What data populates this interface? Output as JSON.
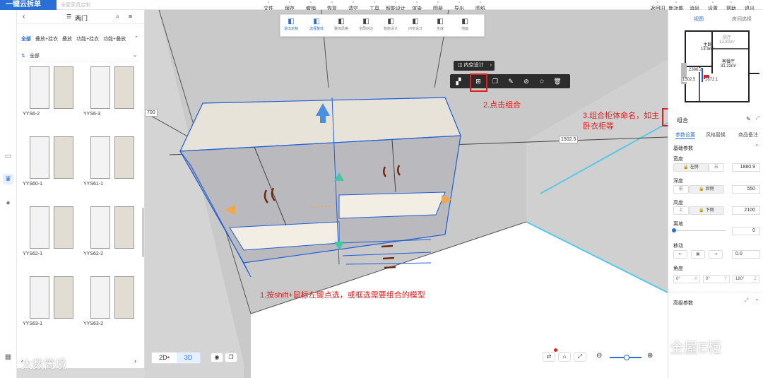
{
  "app": {
    "logo": "一键云拆单",
    "logo_sub": "全屋家具定制"
  },
  "toolbar_center": [
    {
      "icon": "file-icon",
      "label": "文件"
    },
    {
      "icon": "save-icon",
      "label": "保存"
    },
    {
      "icon": "undo-icon",
      "label": "撤销"
    },
    {
      "icon": "redo-icon",
      "label": "恢复"
    },
    {
      "icon": "clear-icon",
      "label": "清空"
    },
    {
      "icon": "tool-icon",
      "label": "工具"
    },
    {
      "icon": "smart-design-icon",
      "label": "智能设计"
    },
    {
      "icon": "render-icon",
      "label": "渲染"
    },
    {
      "icon": "drawing-icon",
      "label": "图册"
    },
    {
      "icon": "export-icon",
      "label": "导出"
    },
    {
      "icon": "blueprint-icon",
      "label": "图纸"
    }
  ],
  "toolbar_right": [
    {
      "icon": "back-icon",
      "label": "返回旧版"
    },
    {
      "icon": "new-feature-icon",
      "label": "新功能"
    },
    {
      "icon": "message-icon",
      "label": "消息"
    },
    {
      "icon": "settings-icon",
      "label": "设置"
    },
    {
      "icon": "help-icon",
      "label": "帮助"
    },
    {
      "icon": "exit-icon",
      "label": "退出"
    }
  ],
  "library": {
    "title": "两门",
    "categories": [
      "全部",
      "叠放+挂衣",
      "叠放",
      "功能+挂衣",
      "功能+叠放"
    ],
    "sort_label": "全部",
    "items": [
      {
        "name": "YYS6-2"
      },
      {
        "name": "YYS6-3"
      },
      {
        "name": "YYS60-1"
      },
      {
        "name": "YYS61-1"
      },
      {
        "name": "YYS62-1"
      },
      {
        "name": "YYS62-2"
      },
      {
        "name": "YYS63-1"
      },
      {
        "name": "YYS63-2"
      }
    ]
  },
  "view_toggle": {
    "two_d": "2D",
    "three_d": "3D",
    "active": "3D"
  },
  "float_toolbar": [
    {
      "icon": "exit-custom-icon",
      "label": "退出定制",
      "active": true
    },
    {
      "icon": "select-whole-icon",
      "label": "选择整体",
      "active": true
    },
    {
      "icon": "whole-style-icon",
      "label": "整体风格"
    },
    {
      "icon": "edge-seal-icon",
      "label": "全局封边"
    },
    {
      "icon": "smart-design-icon",
      "label": "智能设计"
    },
    {
      "icon": "inner-design-icon",
      "label": "内空设计"
    },
    {
      "icon": "generate-icon",
      "label": "生成"
    },
    {
      "icon": "ground-icon",
      "label": "地面"
    }
  ],
  "selection": {
    "inner_design": "内空设计"
  },
  "dimensions": {
    "left": "700",
    "right": "1502.5"
  },
  "annotations": {
    "step1": "1.按shift+鼠标左键点选，或框选需要组合的模型",
    "step2": "2.点击组合",
    "step3": "3.组合柜体命名，如主卧衣柜等"
  },
  "floorplan": {
    "tab_view": "视图",
    "tab_room": "房间选择",
    "rooms": [
      {
        "name": "主卧",
        "area": "13.9m²"
      },
      {
        "name": "厨厅",
        "area": "12.82m²"
      },
      {
        "name": "客餐厅",
        "area": "31.22m²"
      }
    ],
    "dims": [
      "2386.2",
      "1502.5",
      "1672.1"
    ]
  },
  "properties": {
    "group_name": "组合",
    "tabs": [
      "参数设置",
      "风格替换",
      "商品备注"
    ],
    "section_basic": "基础参数",
    "width": {
      "label": "宽度",
      "left": "左侧",
      "right": "右",
      "value": "1880.9"
    },
    "depth": {
      "label": "深度",
      "left": "前",
      "right": "后侧",
      "value": "550"
    },
    "height": {
      "label": "高度",
      "left": "上",
      "right": "下侧",
      "value": "2100"
    },
    "ground": {
      "label": "离地",
      "value": "0"
    },
    "move": {
      "label": "移动",
      "value": "0.0"
    },
    "angle": {
      "label": "角度",
      "x": "0°",
      "y": "0°",
      "z": "180°",
      "xl": "X",
      "yl": "Y",
      "zl": "Z"
    },
    "section_advanced": "高级参数"
  },
  "watermarks": {
    "left": "大数筒境",
    "right": "全屋E柜"
  },
  "colors": {
    "accent": "#2a6fd6",
    "annotation": "#e02020",
    "selection": "#1f5fd8"
  }
}
